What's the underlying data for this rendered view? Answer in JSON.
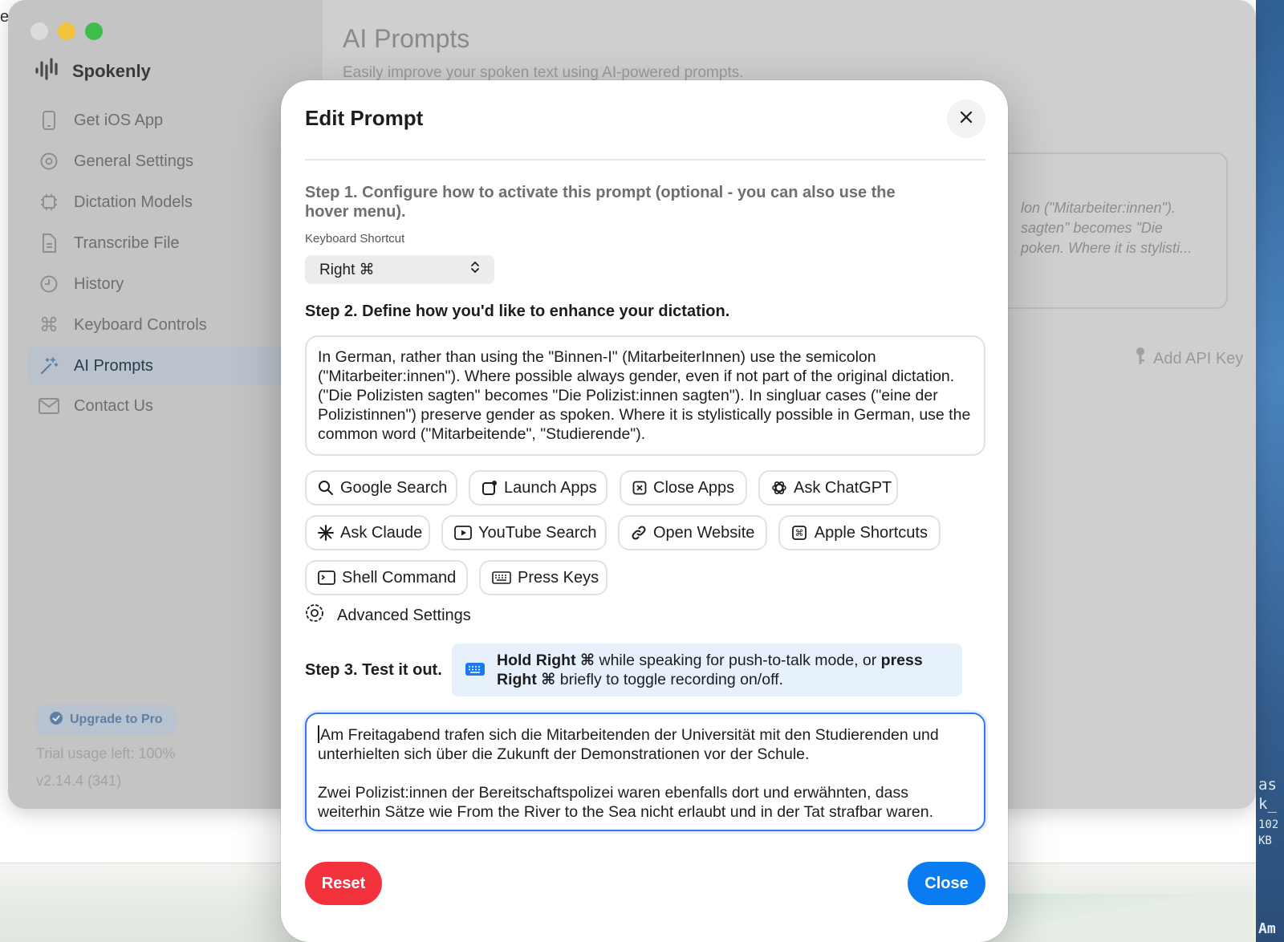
{
  "desktop": {
    "corner_letter": "e",
    "right_label_lines": [
      "as",
      "k_",
      "102",
      "KB"
    ],
    "bottom_right_text": "Am"
  },
  "sidebar": {
    "brand": "Spokenly",
    "items": [
      {
        "label": "Get iOS App",
        "icon": "phone-icon"
      },
      {
        "label": "General Settings",
        "icon": "gear-icon"
      },
      {
        "label": "Dictation Models",
        "icon": "chip-icon"
      },
      {
        "label": "Transcribe File",
        "icon": "document-icon"
      },
      {
        "label": "History",
        "icon": "clock-icon"
      },
      {
        "label": "Keyboard Controls",
        "icon": "command-icon"
      },
      {
        "label": "AI Prompts",
        "icon": "sparkle-wand-icon",
        "active": true
      },
      {
        "label": "Contact Us",
        "icon": "envelope-icon"
      }
    ],
    "upgrade_label": "Upgrade to Pro",
    "trial": "Trial usage left: 100%",
    "version": "v2.14.4 (341)"
  },
  "main": {
    "title": "AI Prompts",
    "subtitle": "Easily improve your spoken text using AI-powered prompts.",
    "card_lines": [
      "lon (\"Mitarbeiter:innen\").",
      "sagten\" becomes \"Die",
      "poken. Where it is stylisti..."
    ],
    "add_api_key": "Add API Key"
  },
  "modal": {
    "title": "Edit Prompt",
    "step1": "Step 1. Configure how to activate this prompt (optional - you can also use the hover menu).",
    "shortcut_label": "Keyboard Shortcut",
    "shortcut_value": "Right ⌘",
    "step2": "Step 2. Define how you'd like to enhance your dictation.",
    "prompt_text": "In German, rather than using the \"Binnen-I\" (MitarbeiterInnen) use the semicolon (\"Mitarbeiter:innen\"). Where possible always gender, even if not part of the original dictation. (\"Die Polizisten sagten\" becomes \"Die Polizist:innen sagten\"). In singluar cases (\"eine der Polizistinnen\") preserve gender as spoken. Where it is stylistically possible in German, use the common word (\"Mitarbeitende\", \"Studierende\").",
    "actions": [
      {
        "label": "Google Search",
        "icon": "search-icon"
      },
      {
        "label": "Launch Apps",
        "icon": "app-launch-icon"
      },
      {
        "label": "Close Apps",
        "icon": "close-box-icon"
      },
      {
        "label": "Ask ChatGPT",
        "icon": "chatgpt-icon"
      },
      {
        "label": "Ask Claude",
        "icon": "claude-icon"
      },
      {
        "label": "YouTube Search",
        "icon": "play-icon"
      },
      {
        "label": "Open Website",
        "icon": "link-icon"
      },
      {
        "label": "Apple Shortcuts",
        "icon": "shortcuts-icon"
      },
      {
        "label": "Shell Command",
        "icon": "terminal-icon"
      },
      {
        "label": "Press Keys",
        "icon": "keyboard-icon"
      }
    ],
    "advanced": "Advanced Settings",
    "step3": "Step 3. Test it out.",
    "hint": {
      "part1": "Hold Right ⌘",
      "part2": " while speaking for push-to-talk mode, or ",
      "part3": "press Right ⌘",
      "part4": " briefly to toggle recording on/off."
    },
    "test_para1": "Am Freitagabend trafen sich die Mitarbeitenden der Universität mit den Studierenden und unterhielten sich über die Zukunft der Demonstrationen vor der Schule.",
    "test_para2": "Zwei Polizist:innen der Bereitschaftspolizei waren ebenfalls dort und erwähnten, dass weiterhin Sätze wie From the River to the Sea nicht erlaubt und in der Tat strafbar waren.",
    "reset": "Reset",
    "close": "Close"
  },
  "colors": {
    "accent_blue": "#0a7cf2",
    "reset_red": "#f4323d",
    "hint_bg": "#e7f1fc"
  }
}
